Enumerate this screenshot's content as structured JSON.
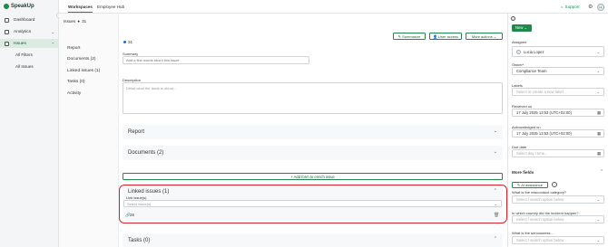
{
  "brand": {
    "name": "SpeakUp"
  },
  "sidebar": {
    "items": [
      {
        "label": "Dashboard"
      },
      {
        "label": "Analytics"
      },
      {
        "label": "Issues"
      }
    ],
    "subitems": [
      {
        "label": "All Filters"
      },
      {
        "label": "All Issues"
      }
    ]
  },
  "topbar": {
    "tabs": [
      {
        "label": "Workspaces"
      },
      {
        "label": "Employee Hub"
      }
    ],
    "support_label": "Support",
    "user_initials": "LL"
  },
  "issue_nav": {
    "breadcrumb_root": "Issues",
    "breadcrumb_id": "31",
    "links": [
      {
        "label": "Report"
      },
      {
        "label": "Documents (2)"
      },
      {
        "label": "Linked issues (1)"
      },
      {
        "label": "Tasks (0)"
      },
      {
        "label": "Activity"
      }
    ]
  },
  "main": {
    "summarize_label": "Summarize",
    "user_access_label": "User access",
    "more_actions_label": "More actions",
    "issue_number": "31",
    "summary_label": "Summary",
    "summary_placeholder": "Add a few words about this issue",
    "description_label": "Description",
    "description_placeholder": "Detail what the issue is about...",
    "sections": [
      {
        "title": "Report"
      },
      {
        "title": "Documents (2)"
      }
    ],
    "add_form_label": "Add form to enrich issue",
    "linked_issues_title": "Linked issues (1)",
    "link_issues_label": "Link issue(s)",
    "link_issues_placeholder": "Select issue(s)",
    "linked_issue_id": "26",
    "tasks_title": "Tasks (0)"
  },
  "right_panel": {
    "new_label": "New",
    "assignee_label": "Assignee",
    "assignee_value": "Lucia Lopez",
    "owner_label": "Owner*",
    "owner_value": "Compliance Team",
    "labels_label": "Labels",
    "labels_placeholder": "Select or create a new label",
    "received_label": "Received on",
    "received_value": "17 July 2025 13:53 (UTC+02:00)",
    "acknowledged_label": "Acknowledged on",
    "acknowledged_value": "17 July 2025 13:53 (UTC+02:00)",
    "due_label": "Due date",
    "due_placeholder": "Select day / time...",
    "more_fields_label": "More fields",
    "ai_label": "AI assistance",
    "misconduct_label": "What is the misconduct category?",
    "misconduct_placeholder": "Select / search option below",
    "country_label": "In which country did the incident happen?",
    "country_placeholder": "Select / search option below",
    "seriousness_label": "What is the seriousness...",
    "seriousness_placeholder": "Select / search option below"
  },
  "colors": {
    "brand_green": "#1f8a4c",
    "highlight_red": "#d6222a",
    "radio_blue": "#1a6ad8"
  },
  "icons": [
    "dashboard-icon",
    "analytics-icon",
    "issues-icon",
    "support-icon",
    "gear-icon",
    "link-icon",
    "trash-icon",
    "calendar-icon",
    "info-icon",
    "chevron-down-icon"
  ]
}
